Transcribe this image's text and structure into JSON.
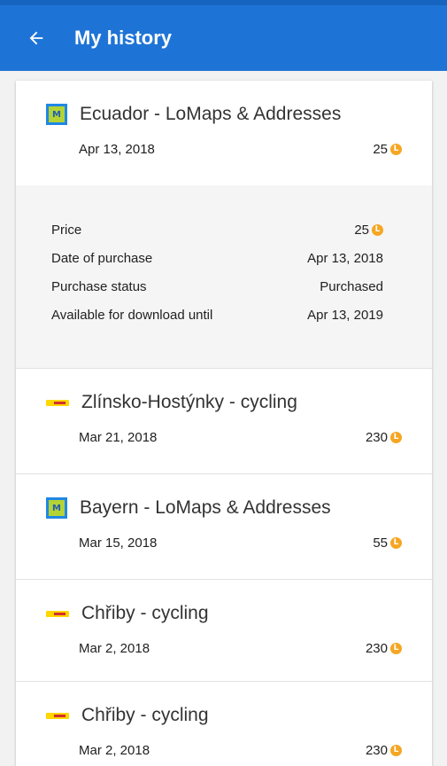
{
  "app_bar": {
    "title": "My history",
    "back_icon": "arrow-left-icon",
    "color": "#1e74d6"
  },
  "expanded_details": {
    "rows": [
      {
        "label": "Price",
        "value": "25",
        "coin": true
      },
      {
        "label": "Date of purchase",
        "value": "Apr 13, 2018",
        "coin": false
      },
      {
        "label": "Purchase status",
        "value": "Purchased",
        "coin": false
      },
      {
        "label": "Available for download until",
        "value": "Apr 13, 2019",
        "coin": false
      }
    ]
  },
  "items": [
    {
      "icon": "lomaps-icon",
      "title": "Ecuador - LoMaps & Addresses",
      "date": "Apr 13, 2018",
      "price": "25"
    },
    {
      "icon": "cycling-map-icon",
      "title": "Zlínsko-Hostýnky - cycling",
      "date": "Mar 21, 2018",
      "price": "230"
    },
    {
      "icon": "lomaps-icon",
      "title": "Bayern - LoMaps & Addresses",
      "date": "Mar 15, 2018",
      "price": "55"
    },
    {
      "icon": "cycling-map-icon",
      "title": "Chřiby - cycling",
      "date": "Mar 2, 2018",
      "price": "230"
    },
    {
      "icon": "cycling-map-icon",
      "title": "Chřiby - cycling",
      "date": "Mar 2, 2018",
      "price": "230"
    }
  ],
  "coin_icon": "credit-coin-icon",
  "coin_glyph": "L",
  "coin_color": "#f5a623"
}
